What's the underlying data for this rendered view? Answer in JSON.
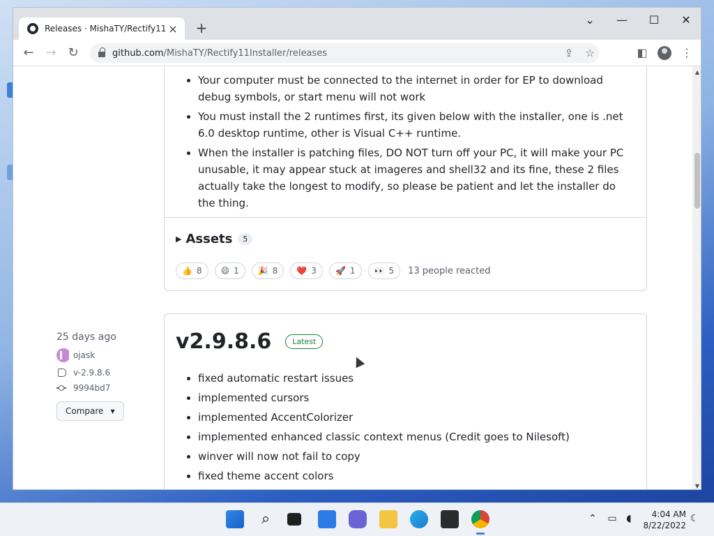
{
  "browser": {
    "tab_title": "Releases · MishaTY/Rectify11Installer",
    "new_tab_icon": "+",
    "url_host": "github.com",
    "url_path": "/MishaTY/Rectify11Installer/releases"
  },
  "release_prev": {
    "notes": [
      "Your computer must be connected to the internet in order for EP to download debug symbols, or start menu will not work",
      "You must install the 2 runtimes first, its given below with the installer, one is .net 6.0 desktop runtime, other is Visual C++ runtime.",
      "When the installer is patching files, DO NOT turn off your PC, it will make your PC unusable, it may appear stuck at imageres and shell32 and its fine, these 2 files actually take the longest to modify, so please be patient and let the installer do the thing."
    ],
    "assets_label": "Assets",
    "assets_count": "5",
    "reactions": [
      {
        "emoji": "👍",
        "count": "8"
      },
      {
        "emoji": "😄",
        "count": "1"
      },
      {
        "emoji": "🎉",
        "count": "8"
      },
      {
        "emoji": "❤️",
        "count": "3"
      },
      {
        "emoji": "🚀",
        "count": "1"
      },
      {
        "emoji": "👀",
        "count": "5"
      }
    ],
    "reacted_text": "13 people reacted"
  },
  "release_meta": {
    "time_ago": "25 days ago",
    "author": "ojask",
    "tag": "v-2.9.8.6",
    "commit": "9994bd7",
    "compare_label": "Compare"
  },
  "release_latest": {
    "version": "v2.9.8.6",
    "badge": "Latest",
    "changes": [
      "fixed automatic restart issues",
      "implemented cursors",
      "implemented AccentColorizer",
      "implemented enhanced classic context menus (Credit goes to Nilesoft)",
      "winver will now not fail to copy",
      "fixed theme accent colors"
    ]
  },
  "taskbar": {
    "time": "4:04 AM",
    "date": "8/22/2022"
  },
  "colors": {
    "link": "#0969da",
    "latest_green": "#1a7f37",
    "border": "#d0d7de"
  }
}
